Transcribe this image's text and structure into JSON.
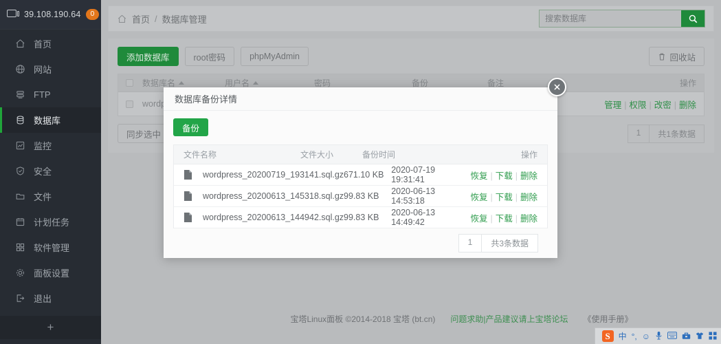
{
  "sidebar": {
    "ip": "39.108.190.64",
    "badge": "0",
    "monitor_icon": "monitor-icon",
    "items": [
      {
        "label": "首页",
        "icon": "home-icon"
      },
      {
        "label": "网站",
        "icon": "globe-icon"
      },
      {
        "label": "FTP",
        "icon": "ftp-icon"
      },
      {
        "label": "数据库",
        "icon": "database-icon"
      },
      {
        "label": "监控",
        "icon": "chart-icon"
      },
      {
        "label": "安全",
        "icon": "shield-icon"
      },
      {
        "label": "文件",
        "icon": "folder-icon"
      },
      {
        "label": "计划任务",
        "icon": "calendar-icon"
      },
      {
        "label": "软件管理",
        "icon": "grid-icon"
      },
      {
        "label": "面板设置",
        "icon": "gear-icon"
      },
      {
        "label": "退出",
        "icon": "logout-icon"
      }
    ],
    "active_index": 3,
    "add_label": "+"
  },
  "header": {
    "home_icon": "home-icon",
    "crumb_home": "首页",
    "crumb_sep": "/",
    "crumb_current": "数据库管理"
  },
  "search": {
    "placeholder": "搜索数据库",
    "value": "",
    "icon": "search-icon"
  },
  "toolbar": {
    "add_db": "添加数据库",
    "root_pass": "root密码",
    "phpmyadmin": "phpMyAdmin",
    "recycle": "回收站",
    "recycle_icon": "trash-icon",
    "sync_selected": "同步选中"
  },
  "table": {
    "columns": {
      "name": "数据库名",
      "user": "用户名",
      "password": "密码",
      "backup": "备份",
      "note": "备注",
      "action": "操作"
    },
    "rows": [
      {
        "name": "wordpr",
        "actions": [
          "管理",
          "权限",
          "改密",
          "删除"
        ]
      }
    ],
    "pager": {
      "page": "1",
      "total": "共1条数据"
    }
  },
  "modal": {
    "title": "数据库备份详情",
    "close_icon": "close-icon",
    "backup_button": "备份",
    "columns": {
      "file": "文件名称",
      "size": "文件大小",
      "time": "备份时间",
      "action": "操作"
    },
    "rows": [
      {
        "icon": "file-icon",
        "file": "wordpress_20200719_193141.sql.gz",
        "size": "671.10 KB",
        "time": "2020-07-19 19:31:41",
        "actions": [
          "恢复",
          "下载",
          "删除"
        ]
      },
      {
        "icon": "file-icon",
        "file": "wordpress_20200613_145318.sql.gz",
        "size": "99.83 KB",
        "time": "2020-06-13 14:53:18",
        "actions": [
          "恢复",
          "下载",
          "删除"
        ]
      },
      {
        "icon": "file-icon",
        "file": "wordpress_20200613_144942.sql.gz",
        "size": "99.83 KB",
        "time": "2020-06-13 14:49:42",
        "actions": [
          "恢复",
          "下载",
          "删除"
        ]
      }
    ],
    "pager": {
      "page": "1",
      "total": "共3条数据"
    }
  },
  "footer": {
    "copyright": "宝塔Linux面板 ©2014-2018 宝塔 (bt.cn)",
    "forum": "问题求助|产品建议请上宝塔论坛",
    "manual": "《使用手册》"
  },
  "ime": {
    "logo": "S",
    "items": [
      {
        "label": "中",
        "icon": "chinese-mode-icon"
      },
      {
        "label": "°,",
        "icon": "punctuation-icon"
      },
      {
        "label": "☺",
        "icon": "emoji-icon"
      },
      {
        "label": "🎤",
        "icon": "microphone-icon"
      },
      {
        "label": "⌨",
        "icon": "keyboard-icon"
      },
      {
        "label": "🧰",
        "icon": "toolbox-icon"
      },
      {
        "label": "👕",
        "icon": "skin-icon"
      },
      {
        "label": "▦",
        "icon": "menu-grid-icon"
      }
    ]
  },
  "colors": {
    "accent_green": "#20a53a",
    "sidebar_bg": "#272c33",
    "badge_orange": "#e2761b"
  }
}
